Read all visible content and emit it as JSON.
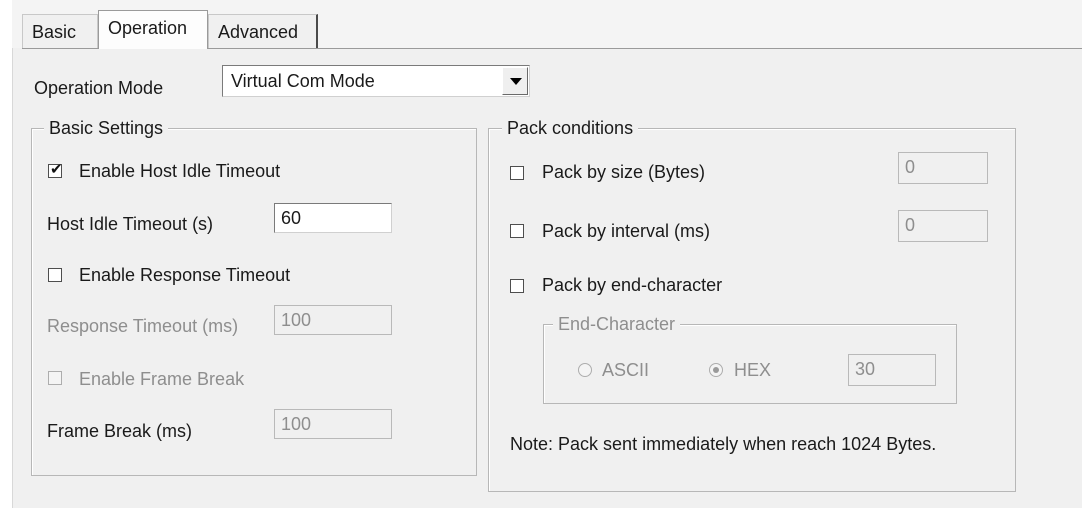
{
  "tabs": [
    {
      "label": "Basic"
    },
    {
      "label": "Operation"
    },
    {
      "label": "Advanced"
    }
  ],
  "operation_mode": {
    "label": "Operation Mode",
    "value": "Virtual Com Mode"
  },
  "basic_settings": {
    "title": "Basic Settings",
    "enable_host_idle_timeout": {
      "label": "Enable Host Idle Timeout",
      "checked": true
    },
    "host_idle_timeout": {
      "label": "Host Idle Timeout (s)",
      "value": "60"
    },
    "enable_response_timeout": {
      "label": "Enable Response Timeout",
      "checked": false
    },
    "response_timeout": {
      "label": "Response Timeout (ms)",
      "value": "100"
    },
    "enable_frame_break": {
      "label": "Enable Frame Break",
      "checked": false
    },
    "frame_break": {
      "label": "Frame Break (ms)",
      "value": "100"
    }
  },
  "pack_conditions": {
    "title": "Pack conditions",
    "by_size": {
      "label": "Pack by size (Bytes)",
      "checked": false,
      "value": "0"
    },
    "by_interval": {
      "label": "Pack by interval (ms)",
      "checked": false,
      "value": "0"
    },
    "by_end_character": {
      "label": "Pack by end-character",
      "checked": false
    },
    "end_character": {
      "title": "End-Character",
      "ascii_label": "ASCII",
      "hex_label": "HEX",
      "selected": "HEX",
      "value": "30"
    },
    "note": "Note: Pack sent immediately when reach 1024 Bytes."
  },
  "icons": {
    "checkmark": "✔"
  }
}
